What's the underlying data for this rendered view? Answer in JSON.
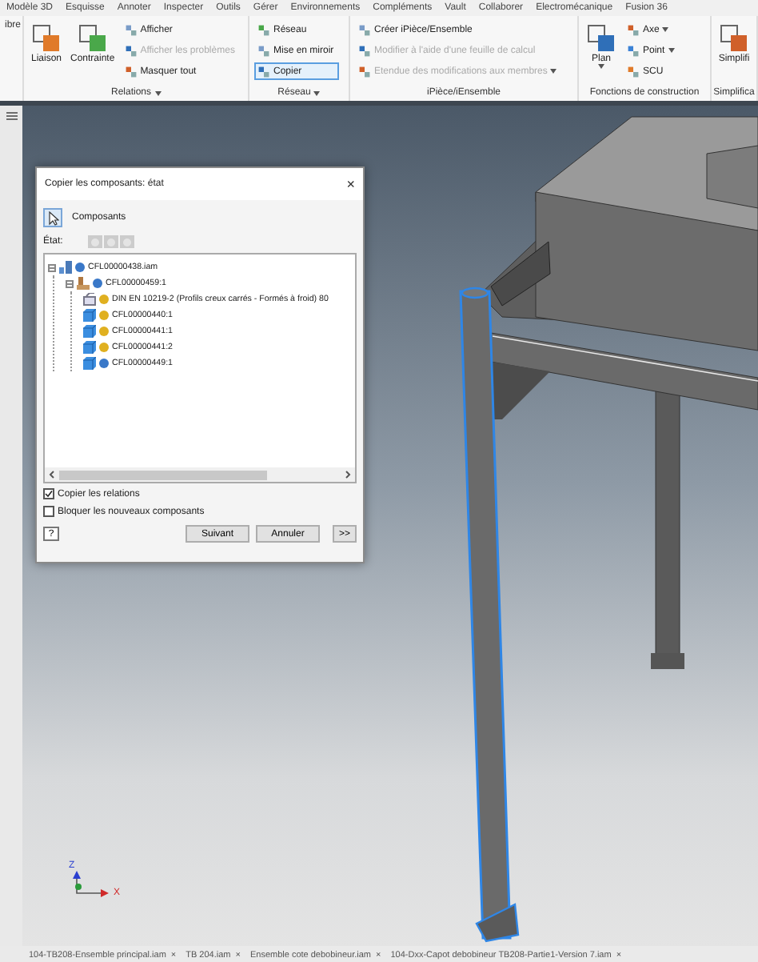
{
  "menu_tabs": [
    "Modèle 3D",
    "Esquisse",
    "Annoter",
    "Inspecter",
    "Outils",
    "Gérer",
    "Environnements",
    "Compléments",
    "Vault",
    "Collaborer",
    "Electromécanique",
    "Fusion 36"
  ],
  "ribbon": {
    "panels": [
      {
        "dropdown": false,
        "tools": [
          {
            "kind": "text",
            "label": "ibre"
          }
        ]
      },
      {
        "label": "Relations",
        "dropdown": true,
        "tools": [
          {
            "kind": "large",
            "label": "Liaison",
            "disabled": false,
            "selected": false,
            "dropdown": false
          },
          {
            "kind": "large",
            "label": "Contrainte",
            "disabled": false,
            "selected": false,
            "dropdown": false
          },
          {
            "kind": "small",
            "label": "Afficher",
            "disabled": false,
            "selected": false,
            "dropdown": false
          },
          {
            "kind": "small",
            "label": "Afficher les problèmes",
            "disabled": true,
            "selected": false,
            "dropdown": false
          },
          {
            "kind": "small",
            "label": "Masquer tout",
            "disabled": false,
            "selected": false,
            "dropdown": false
          }
        ]
      },
      {
        "label": "Réseau",
        "dropdown": true,
        "tools": [
          {
            "kind": "small",
            "label": "Réseau",
            "disabled": false,
            "selected": false,
            "dropdown": false
          },
          {
            "kind": "small",
            "label": "Mise en miroir",
            "disabled": false,
            "selected": false,
            "dropdown": false
          },
          {
            "kind": "small",
            "label": "Copier",
            "disabled": false,
            "selected": true,
            "dropdown": false
          }
        ]
      },
      {
        "label": "iPièce/iEnsemble",
        "dropdown": false,
        "tools": [
          {
            "kind": "small",
            "label": "Créer iPièce/Ensemble",
            "disabled": false,
            "selected": false,
            "dropdown": false
          },
          {
            "kind": "small",
            "label": "Modifier à l'aide d'une feuille de calcul",
            "disabled": true,
            "selected": false,
            "dropdown": false
          },
          {
            "kind": "small",
            "label": "Etendue des modifications aux membres",
            "disabled": true,
            "selected": false,
            "dropdown": true
          }
        ]
      },
      {
        "label": "Fonctions de construction",
        "dropdown": false,
        "tools": [
          {
            "kind": "large",
            "label": "Plan",
            "disabled": false,
            "selected": false,
            "dropdown": true
          },
          {
            "kind": "small",
            "label": "Axe",
            "disabled": false,
            "selected": false,
            "dropdown": true
          },
          {
            "kind": "small",
            "label": "Point",
            "disabled": false,
            "selected": false,
            "dropdown": true
          },
          {
            "kind": "small",
            "label": "SCU",
            "disabled": false,
            "selected": false,
            "dropdown": false
          }
        ]
      },
      {
        "label": "Simplifica",
        "dropdown": false,
        "tools": [
          {
            "kind": "large",
            "label": "Simplifi",
            "disabled": false,
            "selected": false,
            "dropdown": false
          }
        ]
      }
    ]
  },
  "dialog": {
    "title": "Copier les composants: état",
    "close": "×",
    "mode": {
      "label": "Composants",
      "selected": true
    },
    "state_label": "État:",
    "state_buttons": [
      {
        "disabled": true
      },
      {
        "disabled": true
      },
      {
        "disabled": true
      }
    ],
    "tree": [
      {
        "label": "CFL00000438.iam",
        "kind": "assembly",
        "color": "#3a78c8",
        "expanded": true,
        "children": [
          {
            "label": "CFL00000459:1",
            "kind": "subassembly",
            "color": "#3a78c8",
            "expanded": true,
            "children": [
              {
                "label": "DIN EN 10219-2 (Profils creux carrés - Formés à froid) 80",
                "kind": "frame",
                "color": "#e0b020"
              },
              {
                "label": "CFL00000440:1",
                "kind": "part",
                "color": "#e0b020"
              },
              {
                "label": "CFL00000441:1",
                "kind": "part",
                "color": "#e0b020"
              },
              {
                "label": "CFL00000441:2",
                "kind": "part",
                "color": "#e0b020"
              },
              {
                "label": "CFL00000449:1",
                "kind": "part",
                "color": "#3a78c8"
              }
            ]
          }
        ]
      }
    ],
    "options": [
      {
        "label": "Copier les relations",
        "checked": true
      },
      {
        "label": "Bloquer les nouveaux composants",
        "checked": false
      }
    ],
    "help": "?",
    "buttons": [
      "Suivant",
      "Annuler",
      ">>"
    ]
  },
  "viewport": {
    "axes": [
      "Z",
      "X"
    ]
  },
  "document_tabs": [
    {
      "label": "104-TB208-Ensemble principal.iam",
      "close": "×"
    },
    {
      "label": "TB 204.iam",
      "close": "×"
    },
    {
      "label": "Ensemble cote debobineur.iam",
      "close": "×"
    },
    {
      "label": "104-Dxx-Capot debobineur TB208-Partie1-Version 7.iam",
      "close": "×"
    }
  ]
}
